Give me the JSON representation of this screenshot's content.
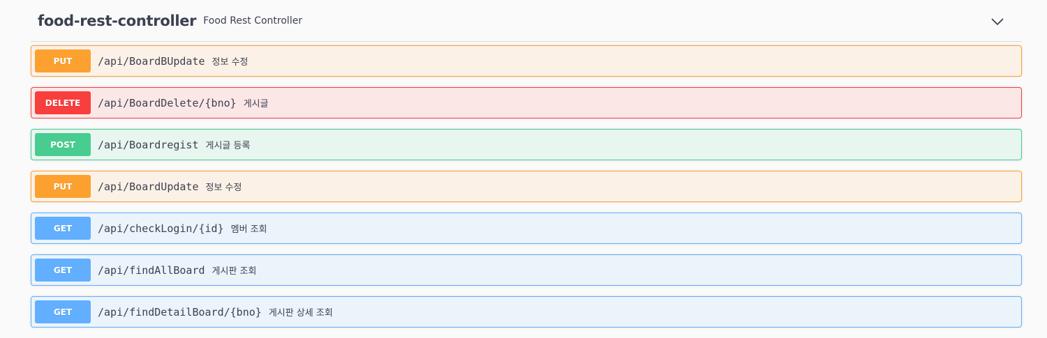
{
  "tag": {
    "title": "food-rest-controller",
    "description": "Food Rest Controller"
  },
  "colors": {
    "PUT": {
      "badge": "#fca130",
      "bg": "#fcf1e6",
      "border": "#fca130"
    },
    "DELETE": {
      "badge": "#f93e3e",
      "bg": "#fce7e7",
      "border": "#f93e3e"
    },
    "POST": {
      "badge": "#49cc90",
      "bg": "#e8f6f0",
      "border": "#49cc90"
    },
    "GET": {
      "badge": "#61affe",
      "bg": "#ebf3fb",
      "border": "#61affe"
    }
  },
  "operations": [
    {
      "method": "PUT",
      "path": "/api/BoardBUpdate",
      "summary": "정보 수정"
    },
    {
      "method": "DELETE",
      "path": "/api/BoardDelete/{bno}",
      "summary": "게시글"
    },
    {
      "method": "POST",
      "path": "/api/Boardregist",
      "summary": "게시글 등록"
    },
    {
      "method": "PUT",
      "path": "/api/BoardUpdate",
      "summary": "정보 수정"
    },
    {
      "method": "GET",
      "path": "/api/checkLogin/{id}",
      "summary": "멤버 조회"
    },
    {
      "method": "GET",
      "path": "/api/findAllBoard",
      "summary": "게시판 조회"
    },
    {
      "method": "GET",
      "path": "/api/findDetailBoard/{bno}",
      "summary": "게시판 상세 조회"
    }
  ]
}
